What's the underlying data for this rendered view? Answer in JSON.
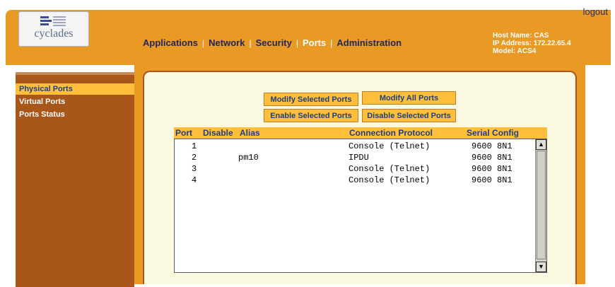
{
  "header": {
    "logo_text": "cyclades",
    "logout_label": "logout",
    "menu": [
      {
        "label": "Applications"
      },
      {
        "label": "Network"
      },
      {
        "label": "Security"
      },
      {
        "label": "Ports"
      },
      {
        "label": "Administration"
      }
    ],
    "separator": "|",
    "host_name": "Host Name: CAS",
    "ip_address": "IP Address: 172.22.65.4",
    "model": "Model: ACS4"
  },
  "sidebar": {
    "items": [
      {
        "label": "Physical Ports"
      },
      {
        "label": "Virtual Ports"
      },
      {
        "label": "Ports Status"
      }
    ]
  },
  "buttons": {
    "modify_selected": "Modify Selected Ports",
    "modify_all": "Modify All Ports",
    "enable_selected": "Enable Selected Ports",
    "disable_selected": "Disable Selected Ports"
  },
  "table": {
    "headers": {
      "port": "Port",
      "disable": "Disable",
      "alias": "Alias",
      "protocol": "Connection Protocol",
      "serial": "Serial Config"
    },
    "rows": [
      {
        "port": "1",
        "alias": "",
        "protocol": "Console (Telnet)",
        "serial": "9600 8N1"
      },
      {
        "port": "2",
        "alias": "pm10",
        "protocol": "IPDU",
        "serial": "9600 8N1"
      },
      {
        "port": "3",
        "alias": "",
        "protocol": "Console (Telnet)",
        "serial": "9600 8N1"
      },
      {
        "port": "4",
        "alias": "",
        "protocol": "Console (Telnet)",
        "serial": "9600 8N1"
      }
    ]
  },
  "colors": {
    "orange": "#e89a24",
    "sidebar_brown": "#a9561a",
    "highlight": "#ffbe3c",
    "navy": "#1e3f82",
    "panel": "#fbf9df"
  }
}
